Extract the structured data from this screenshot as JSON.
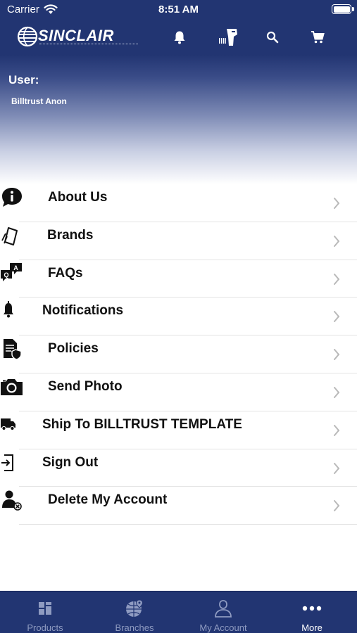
{
  "status_bar": {
    "carrier": "Carrier",
    "time": "8:51 AM"
  },
  "header": {
    "logo_text": "SINCLAIR",
    "icons": [
      "bell-icon",
      "barcode-scanner-icon",
      "search-icon",
      "cart-icon"
    ]
  },
  "user": {
    "label": "User:",
    "name": "Billtrust Anon"
  },
  "menu": {
    "items": [
      {
        "label": "About Us",
        "icon": "info-bubble-icon"
      },
      {
        "label": "Brands",
        "icon": "tag-icon"
      },
      {
        "label": "FAQs",
        "icon": "qa-bubbles-icon"
      },
      {
        "label": "Notifications",
        "icon": "bell-icon"
      },
      {
        "label": "Policies",
        "icon": "policy-document-icon"
      },
      {
        "label": "Send Photo",
        "icon": "camera-icon"
      },
      {
        "label": "Ship To BILLTRUST TEMPLATE",
        "icon": "truck-icon"
      },
      {
        "label": "Sign Out",
        "icon": "sign-out-icon"
      },
      {
        "label": "Delete My Account",
        "icon": "delete-user-icon"
      }
    ]
  },
  "tabbar": {
    "tabs": [
      {
        "label": "Products",
        "icon": "grid-icon",
        "active": false
      },
      {
        "label": "Branches",
        "icon": "globe-pin-icon",
        "active": false
      },
      {
        "label": "My Account",
        "icon": "person-icon",
        "active": false
      },
      {
        "label": "More",
        "icon": "more-dots-icon",
        "active": true
      }
    ]
  },
  "colors": {
    "brand_navy": "#223572",
    "tab_inactive": "#8f9bc1",
    "divider": "#e3e3e3"
  }
}
